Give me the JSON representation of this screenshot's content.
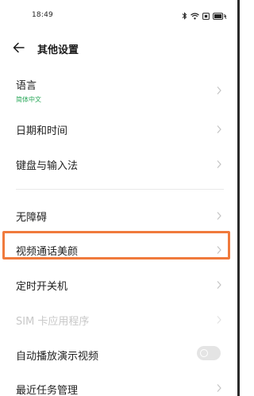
{
  "status": {
    "time": "18:49",
    "icons": [
      "bluetooth-icon",
      "wifi-icon",
      "sim-icon",
      "battery-icon"
    ]
  },
  "header": {
    "title": "其他设置",
    "back_icon": "arrow-left-icon"
  },
  "items": [
    {
      "label": "语言",
      "sublabel": "简体中文",
      "enabled": true
    },
    {
      "label": "日期和时间",
      "enabled": true
    },
    {
      "label": "键盘与输入法",
      "enabled": true
    },
    {
      "label": "无障碍",
      "enabled": true
    },
    {
      "label": "视频通话美颜",
      "enabled": true,
      "highlighted": true
    },
    {
      "label": "定时开关机",
      "enabled": true
    },
    {
      "label": "SIM 卡应用程序",
      "enabled": false
    },
    {
      "label": "自动播放演示视频",
      "enabled": true,
      "toggle": false
    },
    {
      "label": "最近任务管理",
      "enabled": true
    }
  ],
  "colors": {
    "accent_green": "#2aa85a",
    "highlight_orange": "#f07a3c",
    "disabled_text": "#c8c8c8"
  }
}
